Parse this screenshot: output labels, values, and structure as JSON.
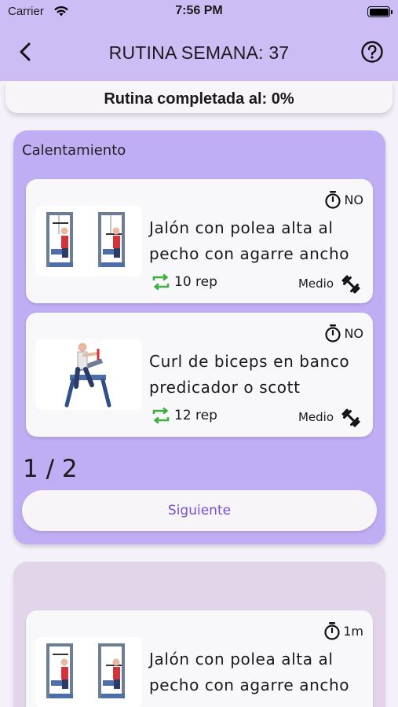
{
  "status_bar": {
    "carrier": "Carrier",
    "time": "7:56 PM"
  },
  "header": {
    "title": "RUTINA SEMANA: 37"
  },
  "progress": {
    "label": "Rutina completada al: 0%"
  },
  "sections": [
    {
      "title": "Calentamiento",
      "exercises": [
        {
          "name": "Jalón con polea alta al pecho con agarre ancho",
          "timer": "NO",
          "reps": "10 rep",
          "level": "Medio"
        },
        {
          "name": "Curl de biceps en banco predicador o scott",
          "timer": "NO",
          "reps": "12 rep",
          "level": "Medio"
        }
      ],
      "pager": "1 / 2",
      "next_label": "Siguiente"
    },
    {
      "title": "",
      "exercises": [
        {
          "name": "Jalón con polea alta al pecho con agarre ancho",
          "timer": "1m"
        }
      ]
    }
  ],
  "colors": {
    "header_bg": "#cdbdf5",
    "section_bg": "#c0aef4",
    "accent": "#7b4fd0",
    "reps_icon": "#3fae3f"
  },
  "icons": {
    "back": "chevron-left-icon",
    "help": "help-circle-icon",
    "timer": "stopwatch-icon",
    "reps": "repeat-icon",
    "level": "dumbbell-icon"
  }
}
